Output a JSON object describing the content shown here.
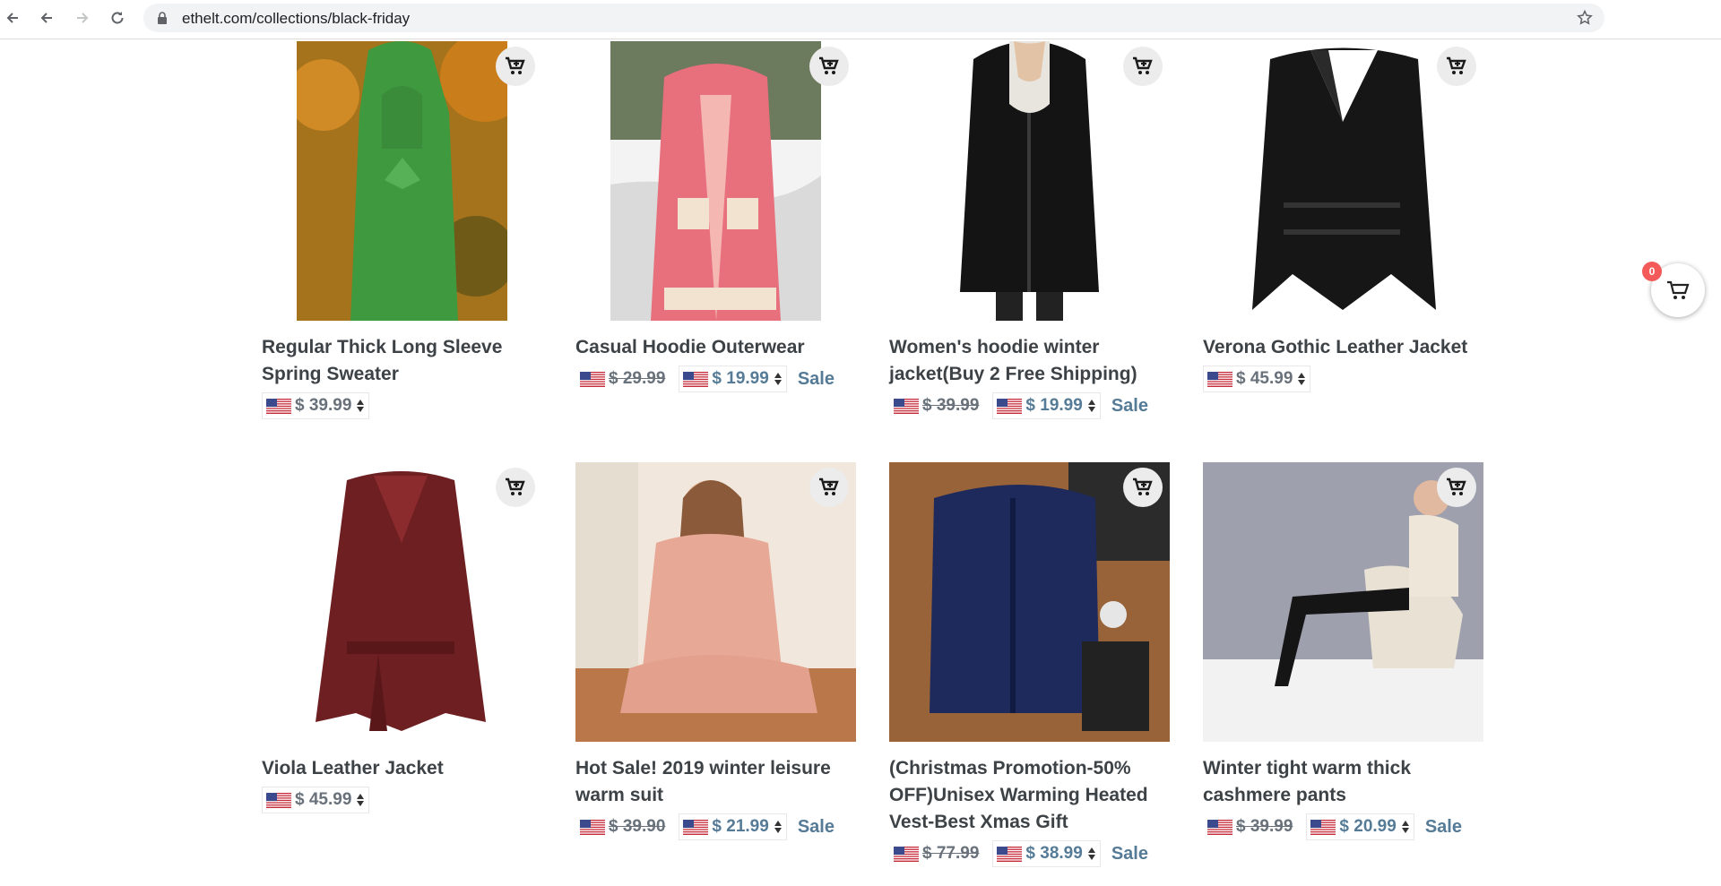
{
  "browser": {
    "url": "ethelt.com/collections/black-friday"
  },
  "cart": {
    "count": "0"
  },
  "products": [
    {
      "title": "Regular Thick Long Sleeve Spring Sweater",
      "price": "$ 39.99"
    },
    {
      "title": "Casual Hoodie Outerwear",
      "compare_price": "$ 29.99",
      "price": "$ 19.99",
      "sale_label": "Sale"
    },
    {
      "title": "Women's hoodie winter jacket(Buy 2 Free Shipping)",
      "compare_price": "$ 39.99",
      "price": "$ 19.99",
      "sale_label": "Sale"
    },
    {
      "title": "Verona Gothic Leather Jacket",
      "price": "$ 45.99"
    },
    {
      "title": "Viola Leather Jacket",
      "price": "$ 45.99"
    },
    {
      "title": "Hot Sale! 2019 winter leisure warm suit",
      "compare_price": "$ 39.90",
      "price": "$ 21.99",
      "sale_label": "Sale"
    },
    {
      "title": "(Christmas Promotion-50% OFF)Unisex Warming Heated Vest-Best Xmas Gift",
      "compare_price": "$ 77.99",
      "price": "$ 38.99",
      "sale_label": "Sale"
    },
    {
      "title": "Winter tight warm thick cashmere pants",
      "compare_price": "$ 39.99",
      "price": "$ 20.99",
      "sale_label": "Sale"
    }
  ],
  "colors": {
    "accent": "#557b97",
    "badge": "#f45a5a",
    "text": "#3d4246"
  }
}
